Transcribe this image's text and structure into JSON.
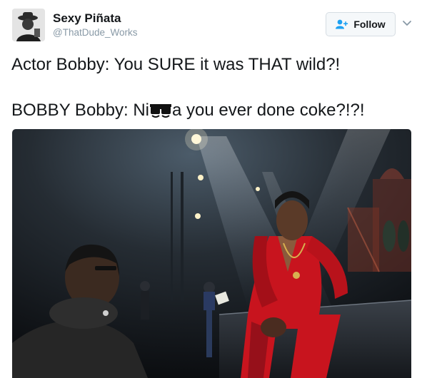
{
  "user": {
    "display_name": "Sexy Piñata",
    "handle": "@ThatDude_Works",
    "avatar_icon": "avatar-photo"
  },
  "follow": {
    "label": "Follow",
    "icon": "add-user-icon",
    "accent": "#1da1f2"
  },
  "menu": {
    "icon": "chevron-down-icon"
  },
  "tweet": {
    "line1": "Actor Bobby: You SURE it was THAT wild?!",
    "line2_prefix": "BOBBY Bobby: Ni",
    "censor_icon": "sunglasses-emoji-icon",
    "line2_suffix": "a you ever done coke?!?!"
  },
  "media": {
    "type": "photo",
    "description_icon": "stage-scene-photo"
  },
  "colors": {
    "text": "#14171a",
    "secondary": "#8899a6",
    "button_bg": "#f5f8fa",
    "button_border": "#d6dde3",
    "costume_red": "#c8141e"
  }
}
